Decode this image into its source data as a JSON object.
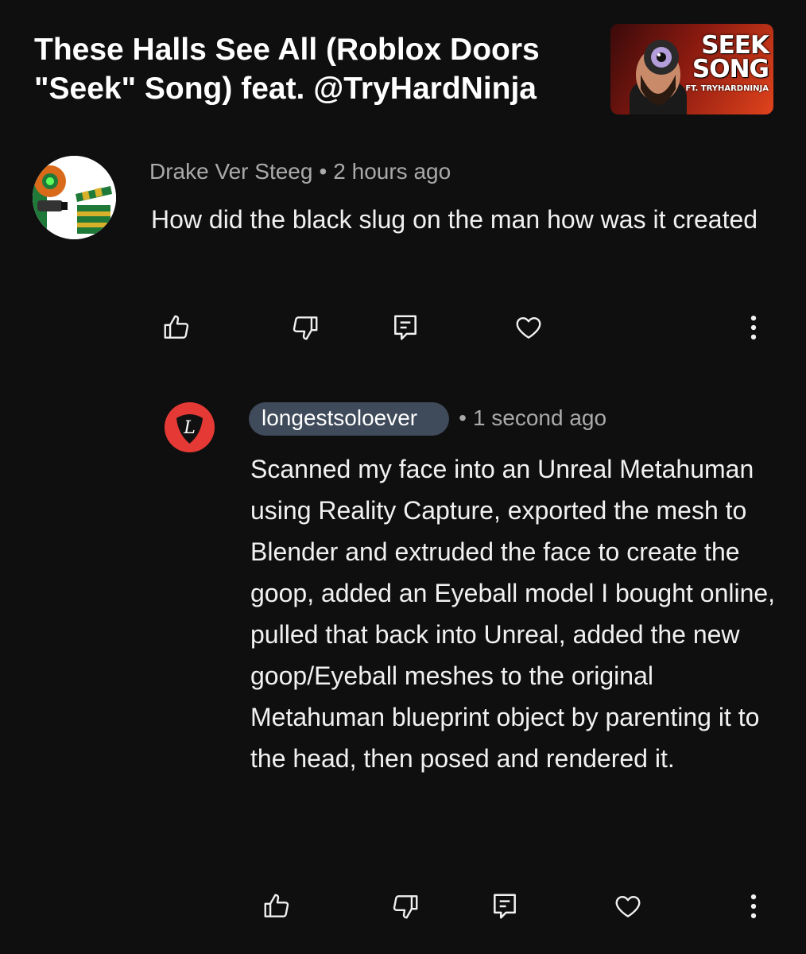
{
  "video": {
    "title": "These Halls See All (Roblox Doors\n\"Seek\" Song) feat. @TryHardNinja",
    "thumbnail": {
      "line1": "SEEK",
      "line2": "SONG",
      "subtitle": "FT. TRYHARDNINJA"
    }
  },
  "comments": [
    {
      "author": "Drake Ver Steeg",
      "separator": "•",
      "time": "2 hours ago",
      "text": "How did the black slug on the man how was it created",
      "avatar_icon": "film-clapper-avatar"
    },
    {
      "author": "longestsoloever",
      "separator": "•",
      "time": "1 second ago",
      "text": "Scanned my face into an Unreal Metahuman using Reality Capture, exported the mesh to Blender and extruded the face to create the goop, added an Eyeball model I bought online, pulled that back into Unreal, added the new goop/Eyeball meshes to the original Metahuman blueprint object by parenting it to the head, then posed and rendered it.",
      "avatar_icon": "guitar-pick-avatar",
      "avatar_letter": "L",
      "is_reply": true
    }
  ],
  "action_icons": [
    "thumbs-up-icon",
    "thumbs-down-icon",
    "reply-icon",
    "heart-icon",
    "more-vertical-icon"
  ],
  "colors": {
    "background": "#0f0f0f",
    "text_primary": "#f1f1f1",
    "text_secondary": "#aaaaaa",
    "username_chip": "#3f4a5a",
    "reply_avatar_red": "#e53935"
  }
}
